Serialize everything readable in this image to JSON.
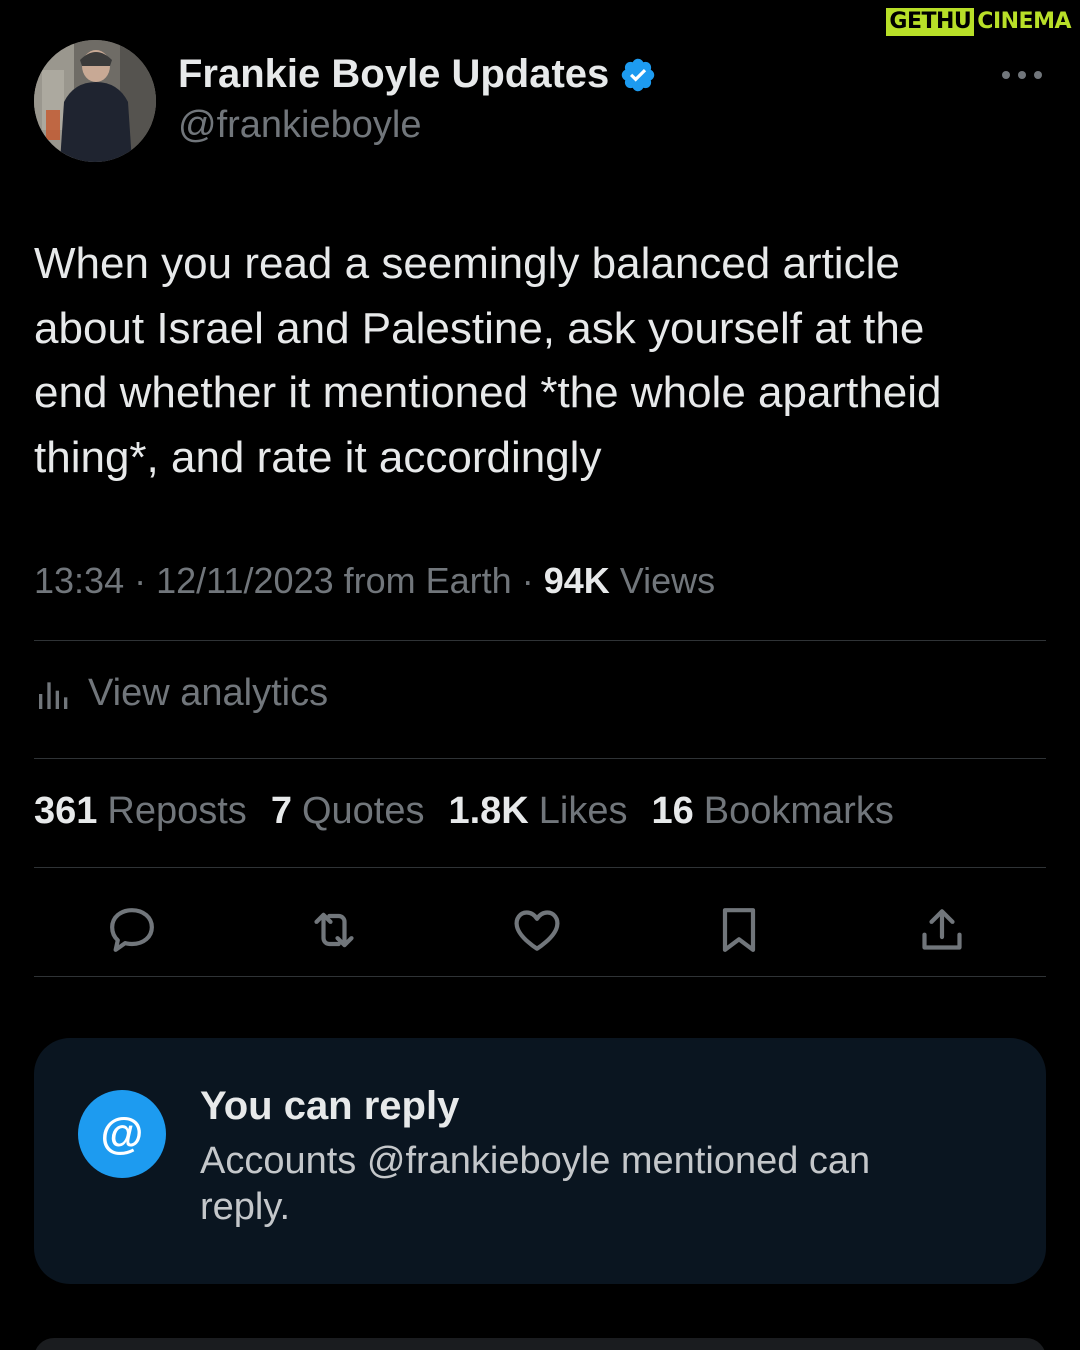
{
  "watermark": {
    "part1": "GETHU",
    "part2": "CINEMA"
  },
  "author": {
    "display_name": "Frankie Boyle Updates",
    "handle": "@frankieboyle",
    "verified": true,
    "verified_color": "#1d9bf0"
  },
  "tweet": {
    "text": "When you read a seemingly balanced article\nabout Israel and Palestine, ask yourself at the\nend whether it mentioned *the whole apartheid\nthing*, and rate it accordingly",
    "time": "13:34",
    "date": "12/11/2023",
    "source": "from Earth",
    "views_count": "94K",
    "views_label": "Views"
  },
  "analytics": {
    "icon": "analytics-icon",
    "label": "View analytics"
  },
  "stats": [
    {
      "count": "361",
      "label": "Reposts"
    },
    {
      "count": "7",
      "label": "Quotes"
    },
    {
      "count": "1.8K",
      "label": "Likes"
    },
    {
      "count": "16",
      "label": "Bookmarks"
    }
  ],
  "actions": [
    "reply-icon",
    "repost-icon",
    "like-icon",
    "bookmark-icon",
    "share-icon"
  ],
  "reply_notice": {
    "icon_glyph": "@",
    "title": "You can reply",
    "description": "Accounts @frankieboyle mentioned can reply."
  },
  "colors": {
    "background": "#000000",
    "text_primary": "#e7e9ea",
    "text_secondary": "#71767b",
    "accent": "#1d9bf0",
    "watermark": "#b8df28"
  }
}
